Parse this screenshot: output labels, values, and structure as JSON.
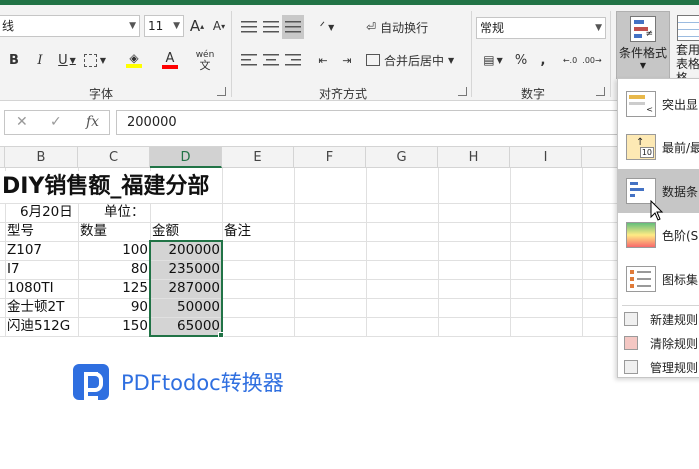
{
  "ribbon": {
    "font_name": "线",
    "font_size": "11",
    "font_grow": "A",
    "font_shrink": "A",
    "bold": "B",
    "italic": "I",
    "underline": "U",
    "font_color_letter": "A",
    "phonetic": "wén",
    "wrap_text": "自动换行",
    "merge_center": "合并后居中",
    "number_format": "常规",
    "percent": "%",
    "comma": ",",
    "groups": {
      "font": "字体",
      "alignment": "对齐方式",
      "number": "数字"
    },
    "conditional_format": "条件格式",
    "table_format": "套用表格格",
    "highlight_color": "#ffff00",
    "font_color": "#ff0000"
  },
  "formula_bar": {
    "value": "200000",
    "cancel": "✕",
    "enter": "✓",
    "fx": "fx"
  },
  "columns": [
    "B",
    "C",
    "D",
    "E",
    "F",
    "G",
    "H",
    "I"
  ],
  "sheet": {
    "title": "DIY销售额_福建分部",
    "date": "6月20日",
    "unit_label": "单位：",
    "headers": [
      "型号",
      "数量",
      "金额",
      "备注"
    ],
    "rows": [
      {
        "model": "Z107",
        "qty": "100",
        "amount": "200000"
      },
      {
        "model": "I7",
        "qty": "80",
        "amount": "235000"
      },
      {
        "model": "1080TI",
        "qty": "125",
        "amount": "287000"
      },
      {
        "model": "金士顿2T",
        "qty": "90",
        "amount": "50000"
      },
      {
        "model": "闪迪512G",
        "qty": "150",
        "amount": "65000"
      }
    ]
  },
  "menu": {
    "items": [
      {
        "label": "突出显",
        "icon": "highlight-cells-icon"
      },
      {
        "label": "最前/最",
        "icon": "top-bottom-icon"
      },
      {
        "label": "数据条",
        "icon": "data-bars-icon"
      },
      {
        "label": "色阶(S",
        "icon": "color-scales-icon"
      },
      {
        "label": "图标集",
        "icon": "icon-sets-icon"
      }
    ],
    "small_items": [
      {
        "label": "新建规则",
        "icon": "new-rule-icon"
      },
      {
        "label": "清除规则",
        "icon": "clear-rules-icon"
      },
      {
        "label": "管理规则",
        "icon": "manage-rules-icon"
      }
    ]
  },
  "watermark": {
    "text": "PDFtodoc转换器",
    "color": "#2f6fe0"
  },
  "accent": "#217346"
}
